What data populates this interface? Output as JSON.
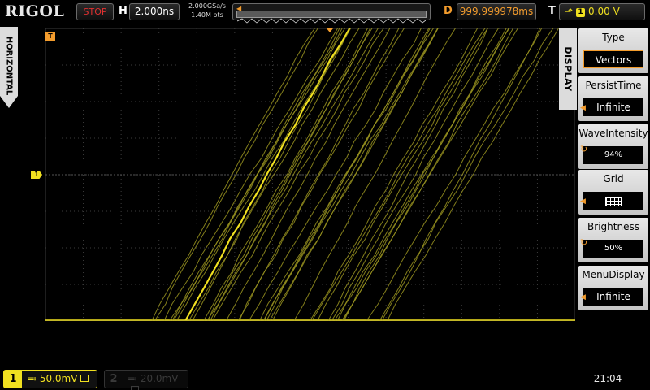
{
  "header": {
    "brand": "RIGOL",
    "run_state": "STOP",
    "horizontal_label": "H",
    "timebase": "2.000ns",
    "sample_rate": "2.000GSa/s",
    "memory_depth": "1.40M pts",
    "delay_label": "D",
    "delay": "999.999978ms",
    "trigger_label": "T",
    "trigger_source": "1",
    "trigger_level": "0.00 V"
  },
  "side_tab": {
    "label": "HORIZONTAL"
  },
  "plot": {
    "trigger_marker": "T",
    "channel_marker": "1"
  },
  "display_menu": {
    "tab_label": "DISPLAY",
    "items": [
      {
        "title": "Type",
        "value": "Vectors"
      },
      {
        "title": "PersistTime",
        "value": "Infinite"
      },
      {
        "title": "WaveIntensity",
        "value": "94%"
      },
      {
        "title": "Grid",
        "value": "grid-full-icon"
      },
      {
        "title": "Brightness",
        "value": "50%"
      },
      {
        "title": "MenuDisplay",
        "value": "Infinite"
      }
    ]
  },
  "footer": {
    "ch1_number": "1",
    "ch1_scale": "50.0mV",
    "ch2_number": "2",
    "ch2_scale": "20.0mV",
    "clock": "21:04"
  },
  "colors": {
    "ch1": "#f0e020",
    "trace": "#9a9420",
    "accent": "#f39c2d",
    "grid": "#3c3c3c",
    "background": "#000000"
  },
  "waveform": {
    "trace_count": 40,
    "bright_trace_index": 32
  }
}
